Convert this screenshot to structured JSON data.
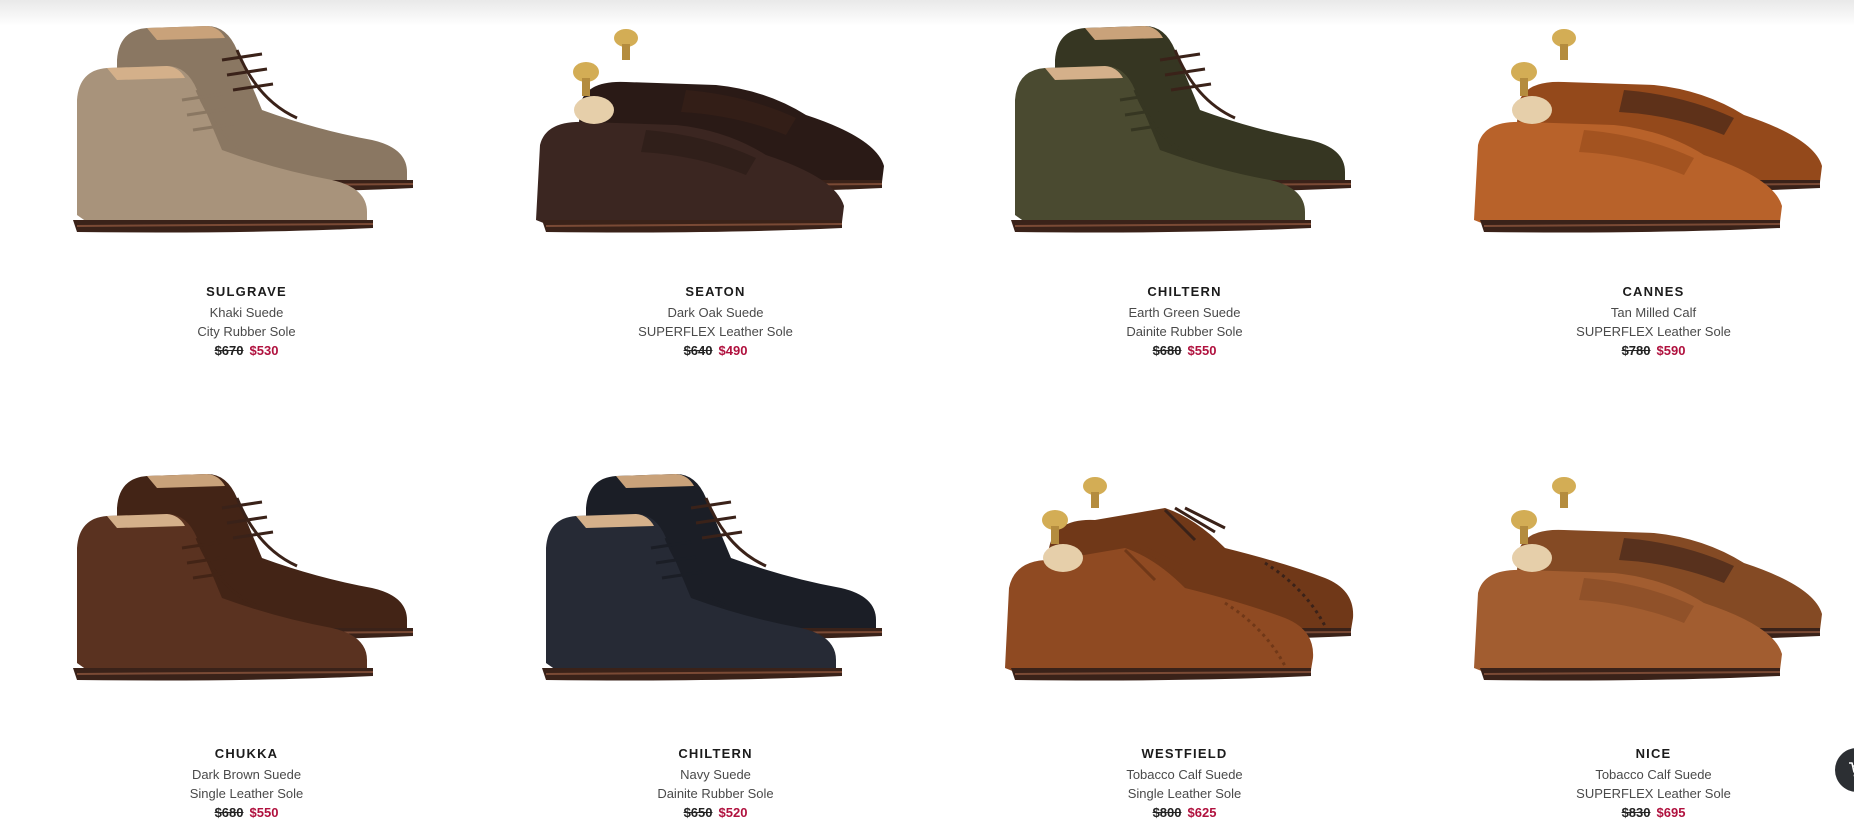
{
  "products": [
    {
      "name": "SULGRAVE",
      "color": "Khaki Suede",
      "sole": "City Rubber Sole",
      "old_price": "$670",
      "new_price": "$530",
      "style": "chukka",
      "upper": "#a8937b",
      "dark": "#8a7762",
      "trees": false
    },
    {
      "name": "SEATON",
      "color": "Dark Oak Suede",
      "sole": "SUPERFLEX Leather Sole",
      "old_price": "$640",
      "new_price": "$490",
      "style": "loafer",
      "upper": "#3b2621",
      "dark": "#2a1a16",
      "trees": true
    },
    {
      "name": "CHILTERN",
      "color": "Earth Green Suede",
      "sole": "Dainite Rubber Sole",
      "old_price": "$680",
      "new_price": "$550",
      "style": "chukka",
      "upper": "#4a4a30",
      "dark": "#363622",
      "trees": false
    },
    {
      "name": "CANNES",
      "color": "Tan Milled Calf",
      "sole": "SUPERFLEX Leather Sole",
      "old_price": "$780",
      "new_price": "$590",
      "style": "loafer",
      "upper": "#b8622a",
      "dark": "#94491b",
      "trees": true
    },
    {
      "name": "CHUKKA",
      "color": "Dark Brown Suede",
      "sole": "Single Leather Sole",
      "old_price": "$680",
      "new_price": "$550",
      "style": "chukka",
      "upper": "#5a3220",
      "dark": "#432416",
      "trees": false
    },
    {
      "name": "CHILTERN",
      "color": "Navy Suede",
      "sole": "Dainite Rubber Sole",
      "old_price": "$650",
      "new_price": "$520",
      "style": "chukka",
      "upper": "#262a35",
      "dark": "#1b1e26",
      "trees": false
    },
    {
      "name": "WESTFIELD",
      "color": "Tobacco Calf Suede",
      "sole": "Single Leather Sole",
      "old_price": "$800",
      "new_price": "$625",
      "style": "oxford",
      "upper": "#8f4a22",
      "dark": "#703818",
      "trees": true
    },
    {
      "name": "NICE",
      "color": "Tobacco Calf Suede",
      "sole": "SUPERFLEX Leather Sole",
      "old_price": "$830",
      "new_price": "$695",
      "style": "loafer",
      "upper": "#a25d30",
      "dark": "#844a24",
      "trees": true
    }
  ],
  "colors": {
    "sale": "#b0113e",
    "text": "#1b1b1b",
    "subtext": "#4a4a4a",
    "fab": "#2c2f33"
  },
  "cart_icon": "cart-icon"
}
